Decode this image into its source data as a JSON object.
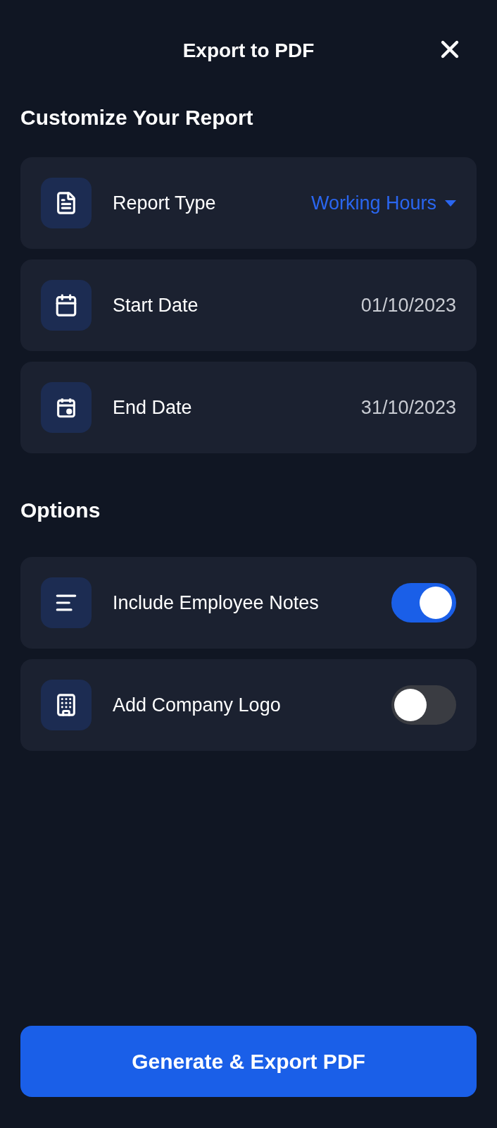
{
  "header": {
    "title": "Export to PDF"
  },
  "customize": {
    "heading": "Customize Your Report",
    "rows": [
      {
        "kind": "select",
        "label": "Report Type",
        "value": "Working Hours"
      },
      {
        "kind": "date",
        "label": "Start Date",
        "value": "01/10/2023"
      },
      {
        "kind": "date",
        "label": "End Date",
        "value": "31/10/2023"
      }
    ]
  },
  "options": {
    "heading": "Options",
    "items": [
      {
        "label": "Include Employee Notes",
        "on": true
      },
      {
        "label": "Add Company Logo",
        "on": false
      }
    ]
  },
  "button": {
    "label": "Generate & Export PDF"
  }
}
